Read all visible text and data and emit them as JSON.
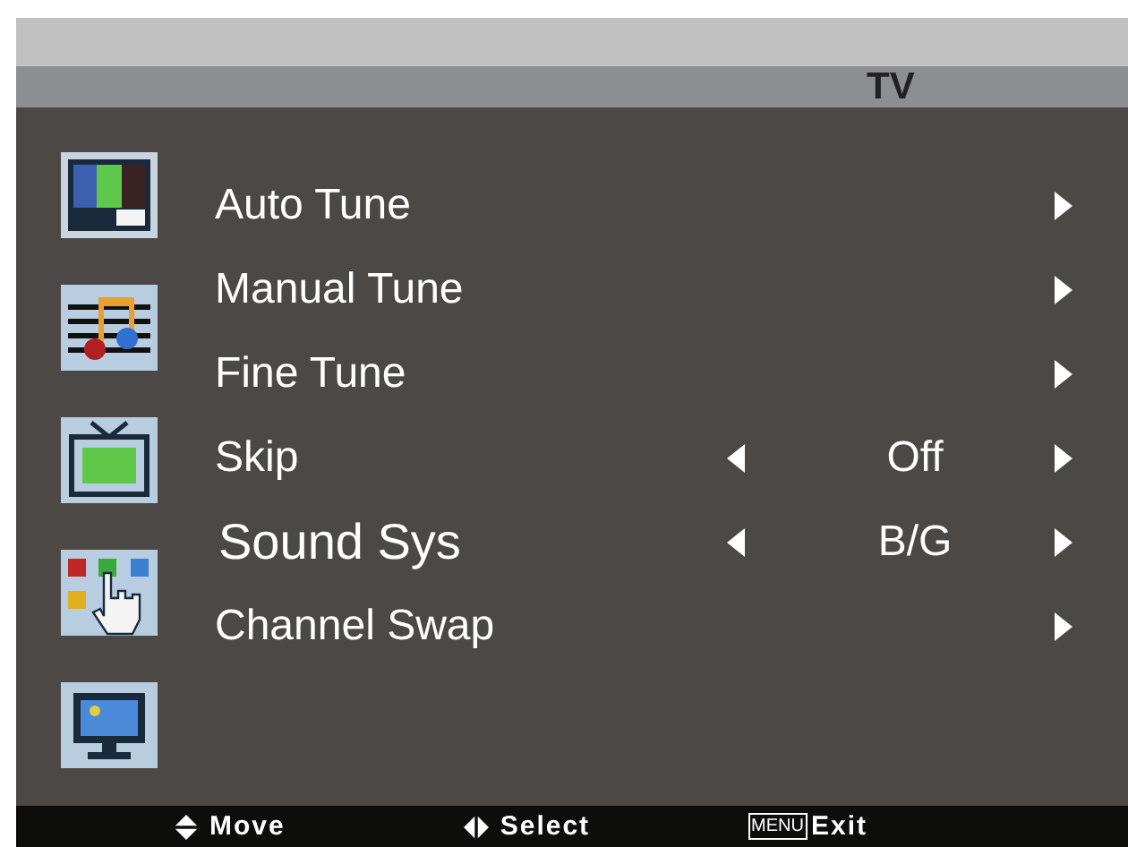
{
  "header": {
    "title": "TV"
  },
  "categories": [
    {
      "kind": "picture"
    },
    {
      "kind": "sound"
    },
    {
      "kind": "channel"
    },
    {
      "kind": "feature"
    },
    {
      "kind": "screen"
    }
  ],
  "menu_items": [
    {
      "label": "Auto Tune",
      "selected": false,
      "kind": "submenu"
    },
    {
      "label": "Manual Tune",
      "selected": false,
      "kind": "submenu"
    },
    {
      "label": "Fine Tune",
      "selected": false,
      "kind": "submenu"
    },
    {
      "label": "Skip",
      "selected": false,
      "kind": "option",
      "value": "Off"
    },
    {
      "label": "Sound Sys",
      "selected": true,
      "kind": "option",
      "value": "B/G"
    },
    {
      "label": "Channel Swap",
      "selected": false,
      "kind": "submenu"
    }
  ],
  "footer": [
    {
      "kind": "updown",
      "label": "Move"
    },
    {
      "kind": "leftright",
      "label": "Select"
    },
    {
      "kind": "menukey",
      "key": "MENU",
      "label": "Exit"
    }
  ]
}
